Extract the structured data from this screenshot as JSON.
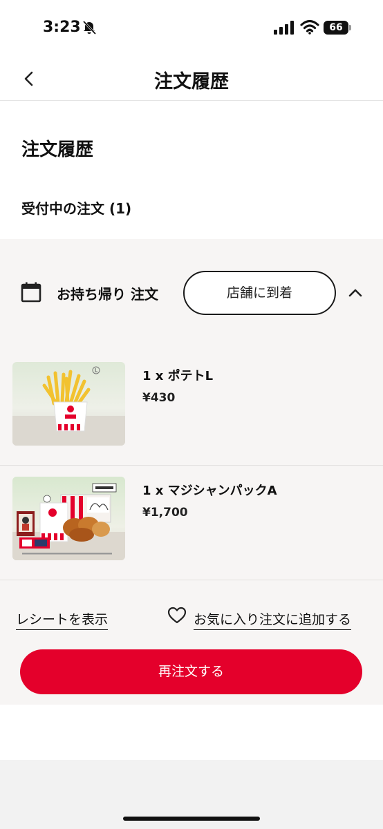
{
  "status_bar": {
    "time": "3:23",
    "battery": "66",
    "icons": [
      "bell-muted-icon",
      "signal-icon",
      "wifi-icon",
      "battery-icon"
    ]
  },
  "header": {
    "title": "注文履歴",
    "back_icon": "chevron-left-icon"
  },
  "page": {
    "section_title": "注文履歴",
    "active_orders_label": "受付中の注文 (1)"
  },
  "order": {
    "type_label": "お持ち帰り 注文",
    "status_label": "店舗に到着",
    "calendar_icon": "calendar-icon",
    "collapse_icon": "chevron-up-icon",
    "items": [
      {
        "name": "1 x ポテトL",
        "price": "¥430"
      },
      {
        "name": "1 x マジシャンパックA",
        "price": "¥1,700"
      }
    ],
    "receipt_label": "レシートを表示",
    "favorite_label": "お気に入り注文に追加する",
    "reorder_label": "再注文する"
  },
  "colors": {
    "brand_red": "#e4002b",
    "card_bg": "#f7f5f4"
  }
}
